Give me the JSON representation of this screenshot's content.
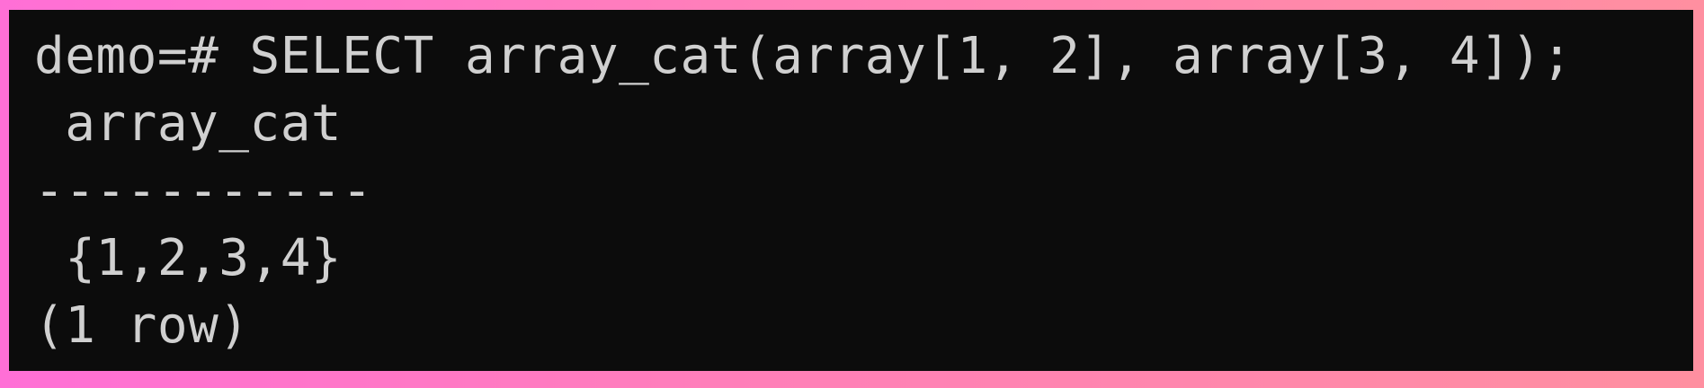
{
  "terminal": {
    "command": "demo=# SELECT array_cat(array[1, 2], array[3, 4]);",
    "column_header": " array_cat",
    "separator": "-----------",
    "result_value": " {1,2,3,4}",
    "row_count": "(1 row)"
  },
  "colors": {
    "terminal_background": "#0c0c0c",
    "text": "#d0d0d0",
    "frame_gradient_start": "#ff6fd6",
    "frame_gradient_end": "#ff8fa0"
  }
}
